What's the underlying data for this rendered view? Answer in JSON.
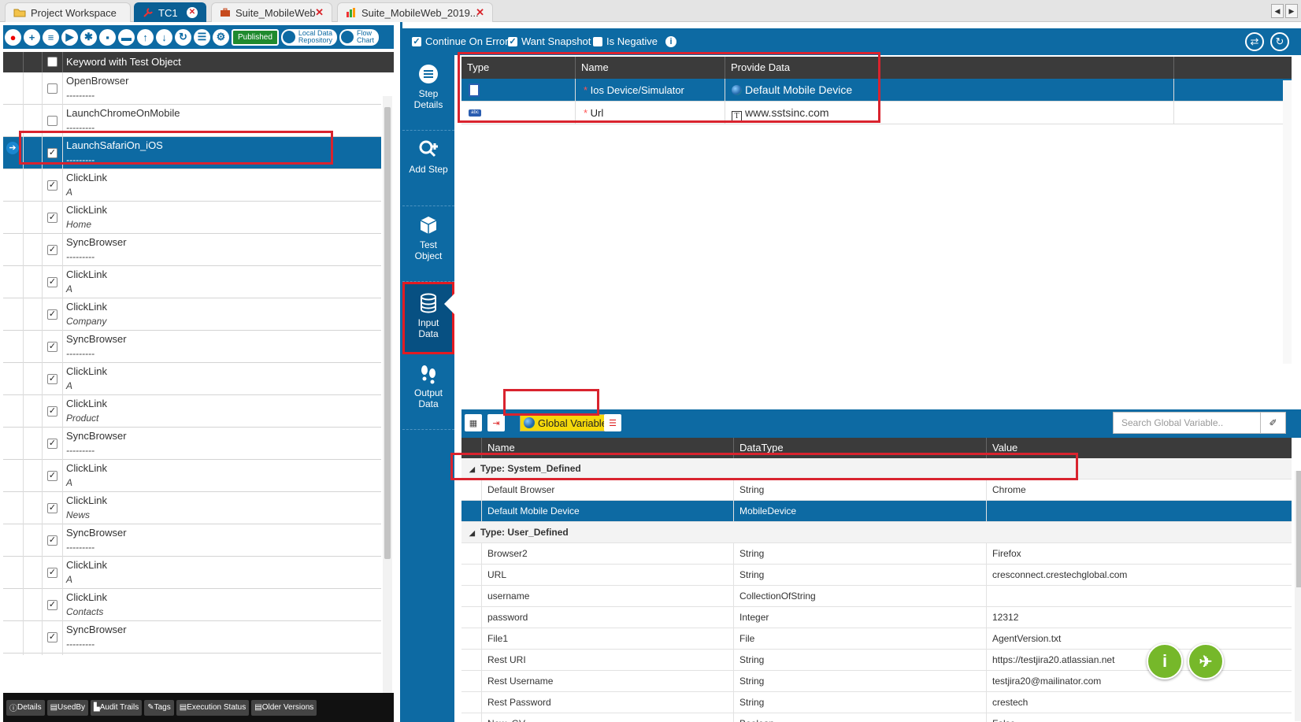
{
  "tabs": [
    {
      "label": "Project Workspace",
      "icon": "folder-icon",
      "active": false
    },
    {
      "label": "TC1",
      "icon": "tool-icon",
      "active": true
    },
    {
      "label": "Suite_MobileWeb",
      "icon": "suitcase-icon",
      "active": false
    },
    {
      "label": "Suite_MobileWeb_2019...",
      "icon": "chart-icon",
      "active": false
    }
  ],
  "left_toolbar": {
    "published": "Published",
    "local_data_line1": "Local Data",
    "local_data_line2": "Repository",
    "flow_line1": "Flow",
    "flow_line2": "Chart"
  },
  "keyword_header": "Keyword with Test Object",
  "keywords": [
    {
      "name": "OpenBrowser",
      "object": "---------",
      "checked": false
    },
    {
      "name": "LaunchChromeOnMobile",
      "object": "---------",
      "checked": false
    },
    {
      "name": "LaunchSafariOn_iOS",
      "object": "---------",
      "checked": true,
      "selected": true
    },
    {
      "name": "ClickLink",
      "object": "A",
      "checked": true
    },
    {
      "name": "ClickLink",
      "object": "Home",
      "checked": true
    },
    {
      "name": "SyncBrowser",
      "object": "---------",
      "checked": true
    },
    {
      "name": "ClickLink",
      "object": "A",
      "checked": true
    },
    {
      "name": "ClickLink",
      "object": "Company",
      "checked": true
    },
    {
      "name": "SyncBrowser",
      "object": "---------",
      "checked": true
    },
    {
      "name": "ClickLink",
      "object": "A",
      "checked": true
    },
    {
      "name": "ClickLink",
      "object": "Product",
      "checked": true
    },
    {
      "name": "SyncBrowser",
      "object": "---------",
      "checked": true
    },
    {
      "name": "ClickLink",
      "object": "A",
      "checked": true
    },
    {
      "name": "ClickLink",
      "object": "News",
      "checked": true
    },
    {
      "name": "SyncBrowser",
      "object": "---------",
      "checked": true
    },
    {
      "name": "ClickLink",
      "object": "A",
      "checked": true
    },
    {
      "name": "ClickLink",
      "object": "Contacts",
      "checked": true
    },
    {
      "name": "SyncBrowser",
      "object": "---------",
      "checked": true
    }
  ],
  "bottom_buttons": [
    "Details",
    "UsedBy",
    "Audit Trails",
    "Tags",
    "Execution Status",
    "Older Versions"
  ],
  "options": {
    "continue_on_error": "Continue On Error",
    "want_snapshot": "Want Snapshot",
    "is_negative": "Is Negative"
  },
  "side_menu": [
    {
      "line1": "Step",
      "line2": "Details"
    },
    {
      "line1": "Add Step",
      "line2": ""
    },
    {
      "line1": "Test",
      "line2": "Object"
    },
    {
      "line1": "Input",
      "line2": "Data"
    },
    {
      "line1": "Output",
      "line2": "Data"
    }
  ],
  "input_table": {
    "headers": [
      "Type",
      "Name",
      "Provide Data"
    ],
    "rows": [
      {
        "name": "Ios Device/Simulator",
        "data": "Default Mobile Device",
        "selected": true
      },
      {
        "name": "Url",
        "data": "www.sstsinc.com",
        "selected": false
      }
    ]
  },
  "global": {
    "button": "Global Variable",
    "search_placeholder": "Search Global Variable..",
    "headers": [
      "Name",
      "DataType",
      "Value"
    ],
    "group1": "Type: System_Defined",
    "system": [
      {
        "name": "Default Browser",
        "type": "String",
        "value": "Chrome"
      },
      {
        "name": "Default Mobile Device",
        "type": "MobileDevice",
        "value": "",
        "selected": true
      }
    ],
    "group2": "Type: User_Defined",
    "user": [
      {
        "name": "Browser2",
        "type": "String",
        "value": "Firefox"
      },
      {
        "name": "URL",
        "type": "String",
        "value": "cresconnect.crestechglobal.com"
      },
      {
        "name": "username",
        "type": "CollectionOfString",
        "value": ""
      },
      {
        "name": "password",
        "type": "Integer",
        "value": "12312"
      },
      {
        "name": "File1",
        "type": "File",
        "value": "AgentVersion.txt"
      },
      {
        "name": "Rest URI",
        "type": "String",
        "value": "https://testjira20.atlassian.net"
      },
      {
        "name": "Rest Username",
        "type": "String",
        "value": "testjira20@mailinator.com"
      },
      {
        "name": "Rest Password",
        "type": "String",
        "value": "crestech"
      },
      {
        "name": "New_GV",
        "type": "Boolean",
        "value": "False"
      }
    ]
  },
  "colors": {
    "primary": "#0d6aa3",
    "highlight": "#d9232e",
    "accent": "#76b82a"
  }
}
